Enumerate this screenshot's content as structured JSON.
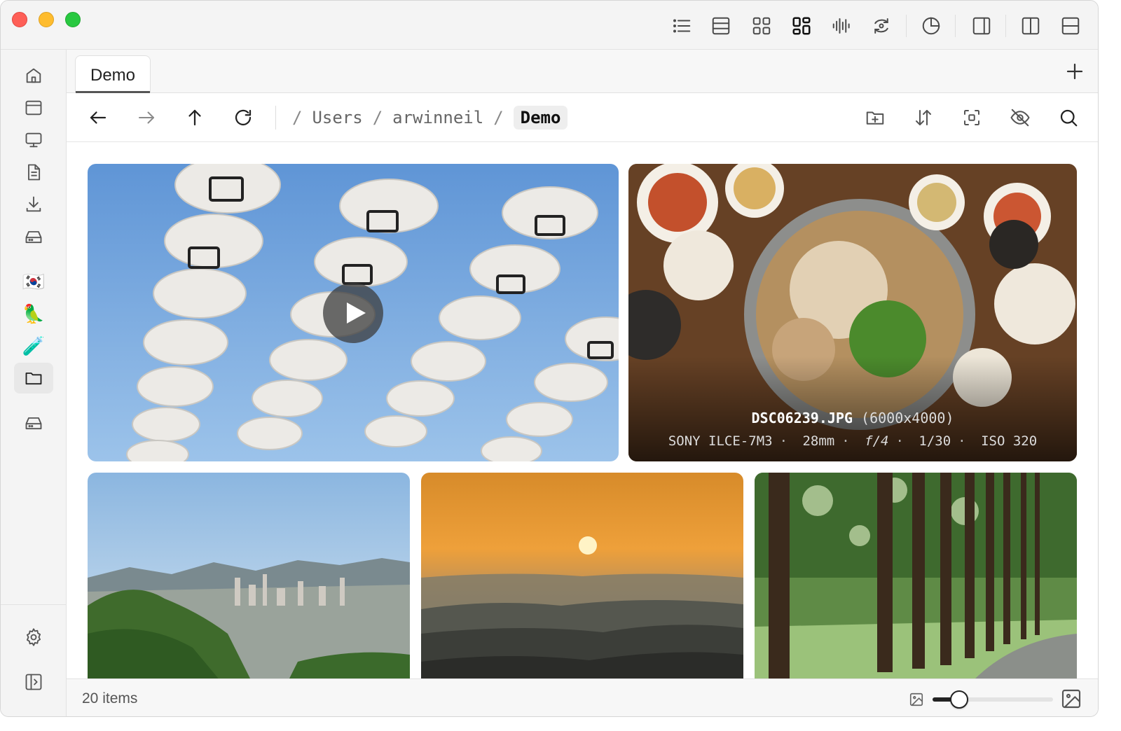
{
  "window": {
    "controls": [
      "close",
      "minimize",
      "zoom"
    ]
  },
  "titlebar": {
    "icons": [
      "list-view-icon",
      "table-view-icon",
      "grid-view-icon",
      "masonry-view-icon",
      "waveform-icon",
      "sync-icon",
      "pie-chart-icon",
      "split-left-icon",
      "split-right-icon",
      "split-bottom-icon"
    ]
  },
  "sidebar": {
    "top_items": [
      "home-icon",
      "window-icon",
      "desktop-icon",
      "document-icon",
      "download-icon",
      "drive-icon"
    ],
    "emoji_items": [
      "🇰🇷",
      "🦜",
      "🧪"
    ],
    "active_item": "folder-icon"
  },
  "tabs": [
    {
      "label": "Demo",
      "active": true
    }
  ],
  "breadcrumb": {
    "root": "/",
    "separator": "/",
    "segments": [
      "Users",
      "arwinneil",
      "Demo"
    ]
  },
  "photo": {
    "filename": "DSC06239.JPG",
    "dimensions": "(6000x4000)",
    "exif": [
      "SONY ILCE-7M3",
      "28mm",
      "f/4",
      "1/30",
      "ISO 320"
    ]
  },
  "status": {
    "item_count": "20 items",
    "zoom_level": 0.22
  },
  "colors": {
    "close": "#fe5f57",
    "minimize": "#febc2e",
    "zoom": "#28c840",
    "slider": "#222222"
  }
}
